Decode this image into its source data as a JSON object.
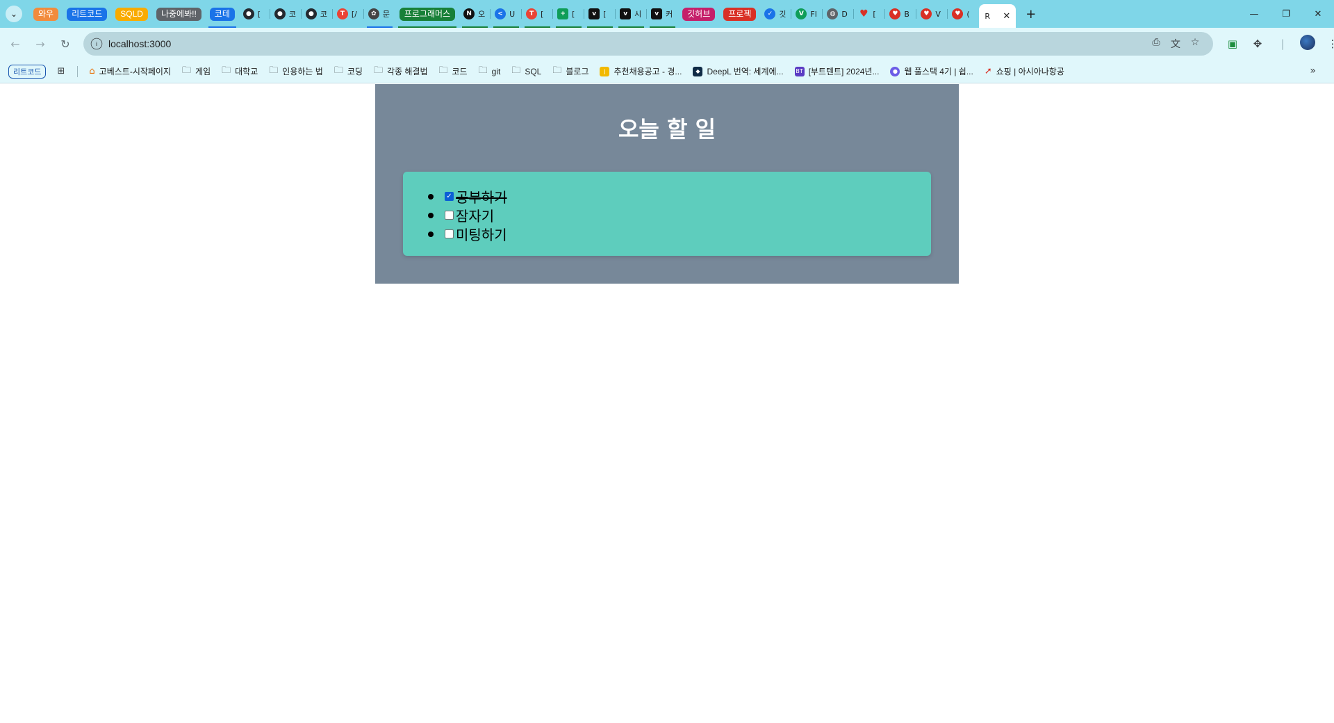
{
  "browser": {
    "tab_groups": [
      {
        "label": "와우",
        "color": "#f28b3c"
      },
      {
        "label": "리트코드",
        "color": "#1a73e8"
      },
      {
        "label": "SQLD",
        "color": "#f9ab00"
      },
      {
        "label": "나중에봐!!",
        "color": "#5f6368"
      },
      {
        "label": "코테",
        "color": "#1a73e8"
      }
    ],
    "tabs_a": [
      {
        "title": "[",
        "icon": "github-icon",
        "color": "#24292f"
      },
      {
        "title": "코",
        "icon": "github-icon",
        "color": "#24292f"
      },
      {
        "title": "코",
        "icon": "github-icon",
        "color": "#24292f"
      },
      {
        "title": "[/",
        "icon": "tomato-icon",
        "color": "#ea4335"
      },
      {
        "title": "문",
        "icon": "openai-icon",
        "color": "#444444"
      }
    ],
    "tab_group_2": {
      "label": "프로그래머스",
      "color": "#188038"
    },
    "tabs_b": [
      {
        "title": "오",
        "icon": "notion-icon",
        "color": "#111111"
      },
      {
        "title": "U",
        "icon": "share-icon",
        "color": "#1a73e8"
      },
      {
        "title": "[",
        "icon": "tomato-icon",
        "color": "#ea4335"
      },
      {
        "title": "[",
        "icon": "sheets-icon",
        "color": "#0f9d58"
      },
      {
        "title": "[",
        "icon": "velog-icon",
        "color": "#111111"
      },
      {
        "title": "시",
        "icon": "velog-icon",
        "color": "#111111"
      },
      {
        "title": "커",
        "icon": "velog-icon",
        "color": "#111111"
      }
    ],
    "tab_group_3": {
      "label": "깃허브",
      "color": "#c51f6a"
    },
    "tab_group_4": {
      "label": "프로젝",
      "color": "#d93025"
    },
    "tabs_c": [
      {
        "title": "깃",
        "icon": "check-icon",
        "color": "#1a73e8"
      },
      {
        "title": "Fl",
        "icon": "vue-icon",
        "color": "#0f9d58"
      },
      {
        "title": "D",
        "icon": "globe-icon",
        "color": "#5f6368"
      },
      {
        "title": "[",
        "icon": "heart-icon",
        "color": "#d93025"
      },
      {
        "title": "B",
        "icon": "shield-icon",
        "color": "#d93025"
      },
      {
        "title": "V",
        "icon": "shield-icon",
        "color": "#d93025"
      },
      {
        "title": "(",
        "icon": "shield-icon",
        "color": "#d93025"
      }
    ],
    "active_tab": {
      "title": "R"
    },
    "url": "localhost:3000",
    "bookmarks_chip": "리트코드",
    "bookmarks": [
      {
        "label": "고베스트-시작페이지",
        "icon": "gobest-icon"
      },
      {
        "label": "게임",
        "icon": "folder-icon"
      },
      {
        "label": "대학교",
        "icon": "folder-icon"
      },
      {
        "label": "인용하는 법",
        "icon": "folder-icon"
      },
      {
        "label": "코딩",
        "icon": "folder-icon"
      },
      {
        "label": "각종 해결법",
        "icon": "folder-icon"
      },
      {
        "label": "코드",
        "icon": "folder-icon"
      },
      {
        "label": "git",
        "icon": "folder-icon"
      },
      {
        "label": "SQL",
        "icon": "folder-icon"
      },
      {
        "label": "블로그",
        "icon": "folder-icon"
      },
      {
        "label": "추천채용공고 - 경...",
        "icon": "jobs-icon"
      },
      {
        "label": "DeepL 번역: 세계에...",
        "icon": "deepl-icon"
      },
      {
        "label": "[부트텐트] 2024년...",
        "icon": "boottent-icon"
      },
      {
        "label": "웹 풀스택 4기 | 쉽...",
        "icon": "course-icon"
      },
      {
        "label": "쇼핑 | 아시아나항공",
        "icon": "asiana-icon"
      }
    ]
  },
  "app": {
    "title": "오늘 할 일",
    "todos": [
      {
        "text": "공부하기",
        "done": true
      },
      {
        "text": "잠자기",
        "done": false
      },
      {
        "text": "미팅하기",
        "done": false
      }
    ]
  }
}
